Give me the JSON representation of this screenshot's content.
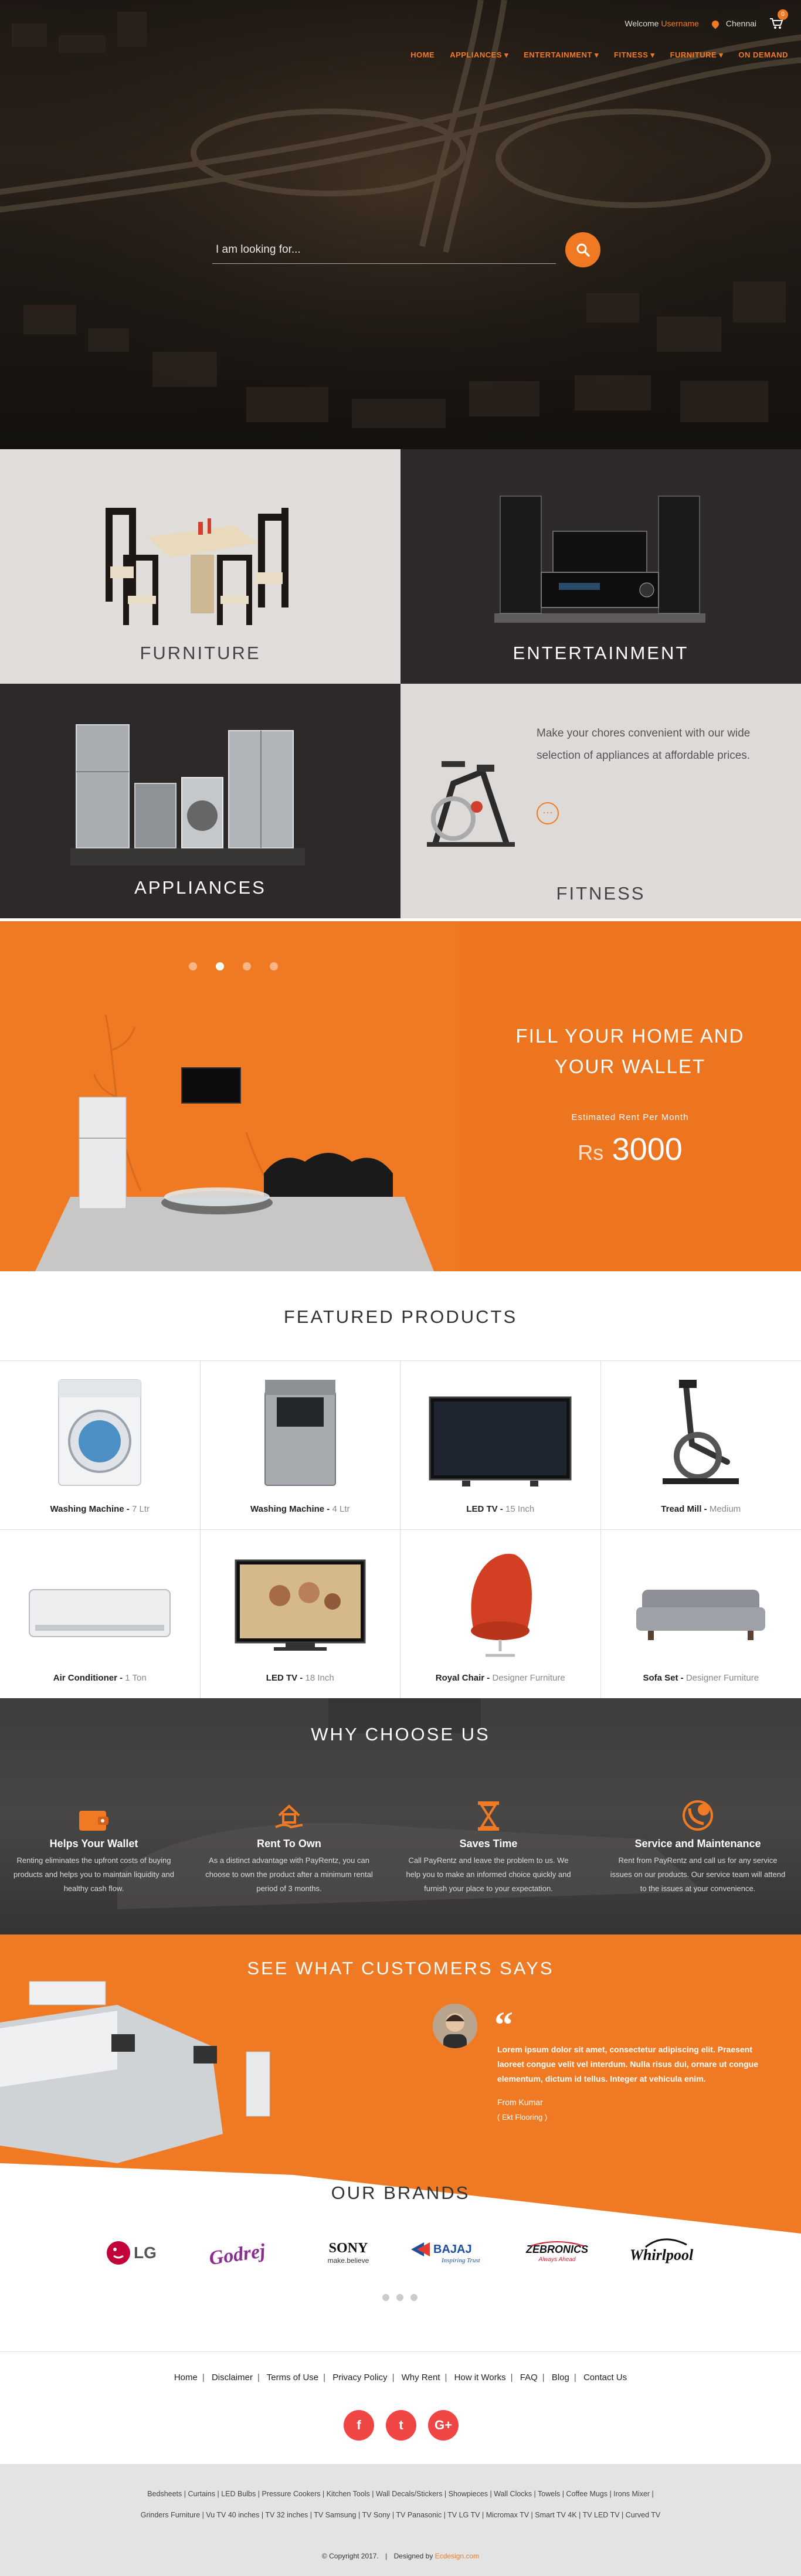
{
  "header": {
    "welcome_prefix": "Welcome",
    "username": "Username",
    "location": "Chennai",
    "cart_count": "0",
    "nav": [
      "HOME",
      "APPLIANCES ▾",
      "ENTERTAINMENT ▾",
      "FITNESS ▾",
      "FURNITURE ▾",
      "ON DEMAND"
    ]
  },
  "search": {
    "placeholder": "I am looking for..."
  },
  "categories": {
    "furniture": "FURNITURE",
    "entertainment": "ENTERTAINMENT",
    "appliances": "APPLIANCES",
    "fitness": "FITNESS",
    "fitness_desc": "Make your chores convenient with our wide selection of appliances at affordable prices.",
    "fitness_more": "···"
  },
  "promo": {
    "heading_line1": "FILL YOUR HOME AND",
    "heading_line2": "YOUR WALLET",
    "estimated_label": "Estimated Rent Per Month",
    "currency": "Rs",
    "amount": "3000",
    "slide_active": 2,
    "slide_count": 4
  },
  "featured": {
    "title": "FEATURED PRODUCTS",
    "products": [
      {
        "name": "Washing Machine",
        "detail": "7 Ltr",
        "icon": "front-load-washer-icon"
      },
      {
        "name": "Washing Machine",
        "detail": "4 Ltr",
        "icon": "top-load-washer-icon"
      },
      {
        "name": "LED TV",
        "detail": "15 Inch",
        "icon": "led-tv-icon"
      },
      {
        "name": "Tread Mill",
        "detail": "Medium",
        "icon": "elliptical-icon"
      },
      {
        "name": "Air Conditioner",
        "detail": "1 Ton",
        "icon": "air-conditioner-icon"
      },
      {
        "name": "LED TV",
        "detail": "18 Inch",
        "icon": "led-tv-family-icon"
      },
      {
        "name": "Royal Chair",
        "detail": "Designer Furniture",
        "icon": "egg-chair-icon"
      },
      {
        "name": "Sofa Set",
        "detail": "Designer Furniture",
        "icon": "sofa-icon"
      }
    ]
  },
  "why": {
    "title": "WHY CHOOSE US",
    "features": [
      {
        "title": "Helps Your Wallet",
        "text": "Renting eliminates the upfront costs of buying products and helps you to maintain liquidity and healthy cash flow."
      },
      {
        "title": "Rent To Own",
        "text": "As a distinct advantage with PayRentz, you can choose to own the product after a minimum rental period of 3 months."
      },
      {
        "title": "Saves Time",
        "text": "Call PayRentz and leave the problem to us. We help you to make an informed choice quickly and furnish your place to your expectation."
      },
      {
        "title": "Service and Maintenance",
        "text": "Rent from PayRentz and call us for any service issues on our products. Our service team will attend to the issues at your convenience."
      }
    ]
  },
  "testimonials": {
    "title": "SEE WHAT CUSTOMERS SAYS",
    "quote": "Lorem ipsum dolor sit amet, consectetur adipiscing elit. Praesent laoreet congue velit vel interdum. Nulla risus dui, ornare ut congue elementum, dictum id tellus. Integer at vehicula enim.",
    "from": "From Kumar",
    "place": "( Ekt Flooring )"
  },
  "brands": {
    "title": "OUR BRANDS",
    "items": [
      "LG",
      "Godrej",
      "SONY",
      "BAJAJ",
      "ZEBRONICS",
      "Whirlpool"
    ],
    "sony_tagline": "make.believe",
    "bajaj_tagline": "Inspiring Trust",
    "zebronics_tagline": "Always Ahead"
  },
  "footer": {
    "links": [
      "Home",
      "Disclaimer",
      "Terms of Use",
      "Privacy Policy",
      "Why Rent",
      "How it Works",
      "FAQ",
      "Blog",
      "Contact Us"
    ],
    "social": [
      "f",
      "t",
      "G+"
    ],
    "tags_line1": "Bedsheets | Curtains | LED Bulbs | Pressure Cookers | Kitchen Tools | Wall Decals/Stickers | Showpieces | Wall Clocks | Towels | Coffee Mugs | Irons Mixer |",
    "tags_line2": "Grinders Furniture | Vu TV 40 inches | TV 32 inches | TV Samsung | TV Sony | TV Panasonic | TV LG TV | Micromax TV | Smart TV 4K | TV LED TV | Curved TV",
    "copyright": "© Copyright 2017.",
    "designed_by_label": "Designed by",
    "designer": "Ecdesign.com"
  },
  "colors": {
    "accent": "#f07a23",
    "dark": "#2d2a29",
    "light": "#e1dddb",
    "social": "#f04545"
  }
}
